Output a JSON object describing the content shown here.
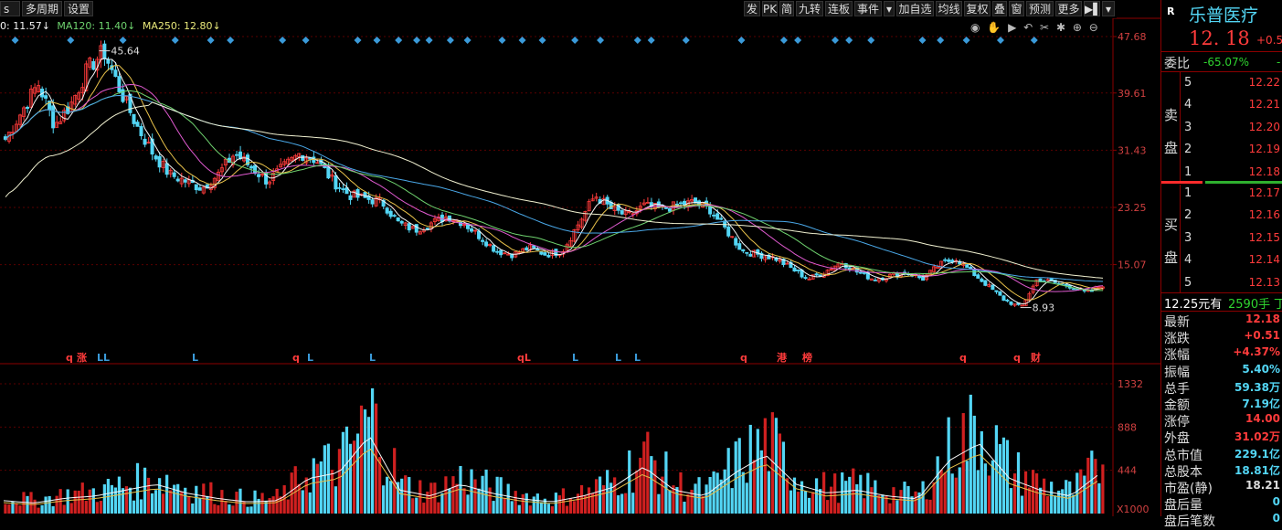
{
  "toolbar": {
    "left": [
      "s",
      "多周期",
      "设置"
    ],
    "right": [
      "发",
      "PK",
      "简",
      "九转",
      "连板",
      "事件",
      "▾",
      "加自选",
      "均线",
      "复权",
      "叠",
      "窗",
      "预测",
      "更多",
      "▶▌",
      "▾"
    ]
  },
  "ma_legend": [
    {
      "text": "0: 11.57↓",
      "color": "#f5f5f5"
    },
    {
      "text": "MA120: 11.40↓",
      "color": "#6fd36f"
    },
    {
      "text": "MA250: 12.80↓",
      "color": "#e8e87a"
    }
  ],
  "chart_data": {
    "type": "candlestick",
    "price_axis": {
      "ticks": [
        "47.68",
        "39.61",
        "31.43",
        "23.25",
        "15.07"
      ]
    },
    "volume_axis": {
      "ticks": [
        "1332",
        "888",
        "444"
      ],
      "unit": "X1000"
    },
    "annotations": {
      "high": "45.64",
      "low": "8.93"
    },
    "signals": [
      "q",
      "涨",
      "LL",
      "L",
      "q",
      "L",
      "L",
      "qL",
      "L",
      "L",
      "L",
      "q",
      "港",
      "榜",
      "q",
      "q",
      "财"
    ],
    "price_path": [
      33,
      37,
      41,
      35,
      38,
      43,
      45.6,
      40,
      35,
      31,
      28,
      27,
      26,
      28,
      31,
      29,
      27,
      29,
      31,
      30,
      27,
      25,
      24.5,
      24,
      21,
      20,
      21,
      22,
      21,
      19,
      17,
      16.5,
      17.5,
      16.5,
      17,
      21,
      25,
      23,
      22,
      23.5,
      23,
      23.5,
      24,
      23,
      20,
      17,
      16.5,
      16,
      14.5,
      13,
      14,
      15.5,
      14,
      13,
      13.5,
      14,
      13,
      15,
      16,
      14,
      12,
      10,
      8.93,
      13,
      12.5,
      12,
      11,
      12.18
    ],
    "volume_peaks": [
      220,
      180,
      260,
      300,
      400,
      500,
      350,
      260,
      200,
      220,
      600,
      700,
      1332,
      400,
      300,
      500,
      350,
      250,
      200,
      300,
      450,
      800,
      400,
      300,
      700,
      1000,
      500,
      350,
      400,
      300,
      250,
      900,
      1200,
      600,
      400,
      300,
      700
    ]
  },
  "panel": {
    "badge": "R",
    "name": "乐普医疗",
    "price": "12. 18",
    "change": "+0.5",
    "weibi_label": "委比",
    "weibi_value": "-65.07%",
    "weibi_dash": "-",
    "sell_label": "卖盘",
    "buy_label": "买盘",
    "sells": [
      {
        "n": "5",
        "p": "12.22"
      },
      {
        "n": "4",
        "p": "12.21"
      },
      {
        "n": "3",
        "p": "12.20"
      },
      {
        "n": "2",
        "p": "12.19"
      },
      {
        "n": "1",
        "p": "12.18"
      }
    ],
    "buys": [
      {
        "n": "1",
        "p": "12.17"
      },
      {
        "n": "2",
        "p": "12.16"
      },
      {
        "n": "3",
        "p": "12.15"
      },
      {
        "n": "4",
        "p": "12.14"
      },
      {
        "n": "5",
        "p": "12.13"
      }
    ],
    "notice_price": "12.25元有",
    "notice_vol": "2590手",
    "notice_tail": "丁",
    "stats": [
      {
        "label": "最新",
        "value": "12.18",
        "cls": ""
      },
      {
        "label": "涨跌",
        "value": "+0.51",
        "cls": ""
      },
      {
        "label": "涨幅",
        "value": "+4.37%",
        "cls": ""
      },
      {
        "label": "振幅",
        "value": "5.40%",
        "cls": "vcyan"
      },
      {
        "label": "总手",
        "value": "59.38万",
        "cls": "vcyan"
      },
      {
        "label": "金额",
        "value": "7.19亿",
        "cls": "vcyan"
      },
      {
        "label": "涨停",
        "value": "14.00",
        "cls": ""
      },
      {
        "label": "外盘",
        "value": "31.02万",
        "cls": ""
      },
      {
        "label": "总市值",
        "value": "229.1亿",
        "cls": "vcyan"
      },
      {
        "label": "总股本",
        "value": "18.81亿",
        "cls": "vcyan"
      },
      {
        "label": "市盈(静)",
        "value": "18.21",
        "cls": "vwhite"
      },
      {
        "label": "盘后量",
        "value": "0",
        "cls": "vcyan"
      },
      {
        "label": "盘后笔数",
        "value": "0",
        "cls": "vcyan"
      }
    ]
  }
}
